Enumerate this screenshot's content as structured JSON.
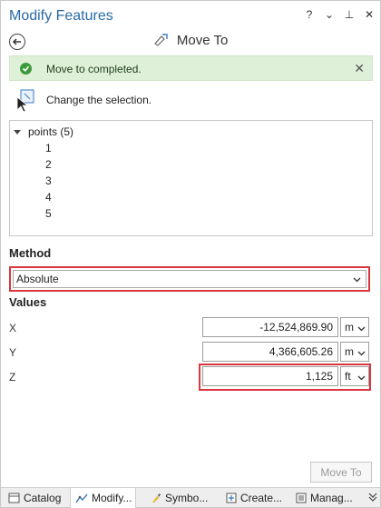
{
  "panel": {
    "title": "Modify Features",
    "help": "?",
    "menu": "⌄",
    "pin": "⊥",
    "close": "✕"
  },
  "tool": {
    "title": "Move To"
  },
  "message": {
    "text": "Move to completed."
  },
  "selection": {
    "change_label": "Change the selection."
  },
  "tree": {
    "root": "points (5)",
    "items": [
      "1",
      "2",
      "3",
      "4",
      "5"
    ]
  },
  "method": {
    "label": "Method",
    "value": "Absolute"
  },
  "values": {
    "label": "Values",
    "x": {
      "label": "X",
      "value": "-12,524,869.90",
      "unit": "m"
    },
    "y": {
      "label": "Y",
      "value": "4,366,605.26",
      "unit": "m"
    },
    "z": {
      "label": "Z",
      "value": "1,125",
      "unit": "ft"
    }
  },
  "actions": {
    "move_to": "Move To"
  },
  "tabs": [
    {
      "label": "Catalog"
    },
    {
      "label": "Modify..."
    },
    {
      "label": "Symbo..."
    },
    {
      "label": "Create..."
    },
    {
      "label": "Manag..."
    }
  ],
  "colors": {
    "accent": "#2a6aa8",
    "success_bg": "#dff0d8",
    "success_icon": "#3c9a3c",
    "highlight": "#d9363e"
  }
}
